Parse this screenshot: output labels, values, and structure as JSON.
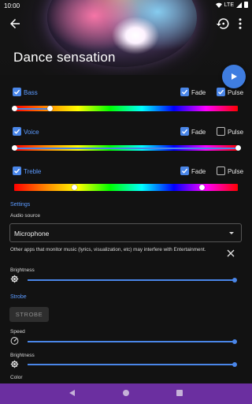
{
  "status_bar": {
    "time": "10:00",
    "network": "LTE"
  },
  "header": {
    "title": "Dance sensation"
  },
  "bands": [
    {
      "label": "Bass",
      "fade_label": "Fade",
      "pulse_label": "Pulse",
      "band_checked": true,
      "fade_checked": true,
      "pulse_checked": true,
      "range_start": 0.0,
      "range_end": 0.16
    },
    {
      "label": "Voice",
      "fade_label": "Fade",
      "pulse_label": "Pulse",
      "band_checked": true,
      "fade_checked": true,
      "pulse_checked": false,
      "range_start": 0.0,
      "range_end": 1.0
    },
    {
      "label": "Treble",
      "fade_label": "Fade",
      "pulse_label": "Pulse",
      "band_checked": true,
      "fade_checked": true,
      "pulse_checked": false,
      "range_start": 0.27,
      "range_end": 0.84
    }
  ],
  "settings": {
    "section_title": "Settings",
    "audio_source_label": "Audio source",
    "audio_source_value": "Microphone",
    "notice": "Other apps that monitor music (lyrics, visualization, etc) may interfere with Entertainment.",
    "brightness_label": "Brightness",
    "brightness_value": 1.0
  },
  "strobe": {
    "section_title": "Strobe",
    "button_label": "STROBE",
    "speed_label": "Speed",
    "speed_value": 1.0,
    "brightness_label": "Brightness",
    "brightness_value": 1.0,
    "color_label": "Color"
  },
  "colors": {
    "accent": "#4a86e8",
    "accent_text": "#5c9bff",
    "fab": "#3f7de0",
    "nav_bar": "#6b2fa0",
    "background": "#121212"
  },
  "icons": {
    "back": "arrow-back-icon",
    "reset": "reset-icon",
    "more": "more-vert-icon",
    "play": "play-icon",
    "close": "close-icon",
    "brightness": "brightness-icon",
    "speed": "speed-icon",
    "nav_back": "nav-back-icon",
    "nav_home": "nav-home-icon",
    "nav_recent": "nav-recents-icon"
  }
}
